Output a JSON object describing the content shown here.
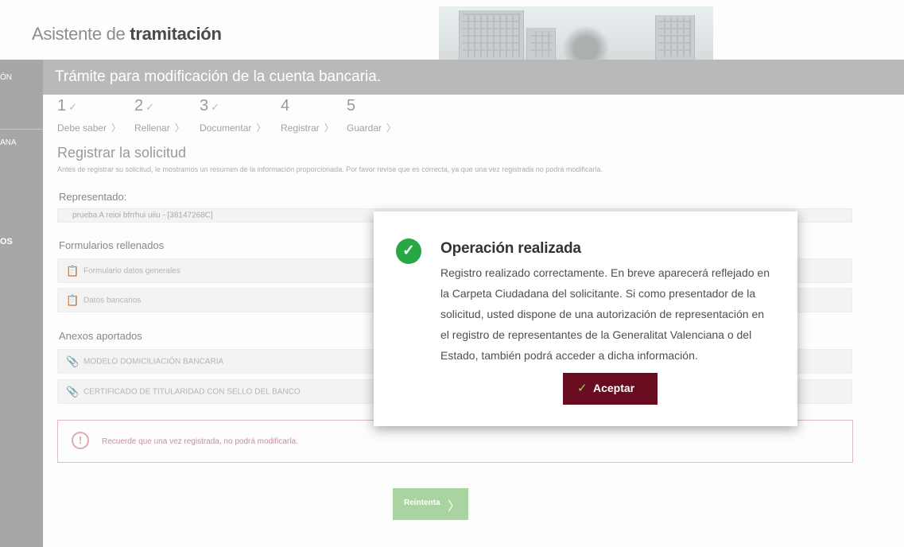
{
  "header": {
    "title_light": "Asistente de",
    "title_bold": "tramitación"
  },
  "left_rail": {
    "items": [
      "ÓN",
      "ANA",
      "OS"
    ]
  },
  "banner": {
    "title": "Trámite para modificación de la cuenta bancaria."
  },
  "steps": [
    {
      "number": "1",
      "done": "✓",
      "label": "Debe saber"
    },
    {
      "number": "2",
      "done": "✓",
      "label": "Rellenar"
    },
    {
      "number": "3",
      "done": "✓",
      "label": "Documentar"
    },
    {
      "number": "4",
      "done": "",
      "label": "Registrar"
    },
    {
      "number": "5",
      "done": "",
      "label": "Guardar"
    }
  ],
  "main": {
    "section_title": "Registrar la solicitud",
    "section_desc": "Antes de registrar su solicitud, le mostramos un resumen de la información proporcionada. Por favor revise que es correcta, ya que una vez registrada no podrá modificarla.",
    "represented_label": "Representado:",
    "represented_value": "prueba A reioi bfrrhui uiiu - [38147268C]",
    "forms_label": "Formularios rellenados",
    "forms": [
      "Formulario datos generales",
      "Datos bancarios"
    ],
    "annexes_label": "Anexos aportados",
    "annexes": [
      "MODELO DOMICILIACIÓN BANCARIA",
      "CERTIFICADO DE TITULARIDAD CON SELLO DEL BANCO"
    ],
    "notice": "Recuerde que una vez registrada, no podrá modificarla.",
    "retry_label": "Reintenta"
  },
  "modal": {
    "title": "Operación realizada",
    "body": "Registro realizado correctamente. En breve aparecerá reflejado en la Carpeta Ciudadana del solicitante. Si como presentador de la solicitud, usted dispone de una autorización de representación en el registro de representantes de la Generalitat Valenciana o del Estado, también podrá acceder a dicha información.",
    "accept_label": "Aceptar"
  },
  "colors": {
    "accent": "#6a0c1f",
    "success": "#28a745",
    "retry": "#a9d39f"
  }
}
